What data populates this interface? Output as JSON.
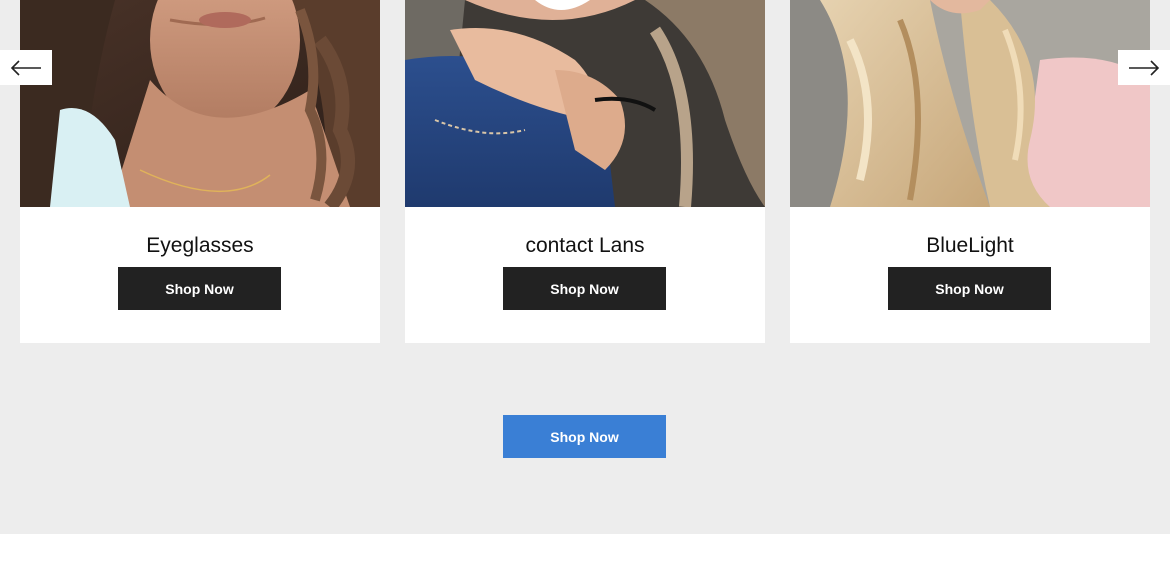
{
  "colors": {
    "section_bg": "#ededed",
    "card_button_bg": "#222222",
    "primary_button_bg": "#3a7fd5"
  },
  "carousel": {
    "prev_icon": "arrow-left-icon",
    "next_icon": "arrow-right-icon",
    "cards": [
      {
        "image": "woman-curly-hair-photo",
        "title": "Eyeglasses",
        "button_label": "Shop Now"
      },
      {
        "image": "woman-denim-smiling-photo",
        "title": "contact Lans",
        "button_label": "Shop Now"
      },
      {
        "image": "woman-blonde-hair-photo",
        "title": "BlueLight",
        "button_label": "Shop Now"
      }
    ]
  },
  "cta": {
    "label": "Shop Now"
  }
}
